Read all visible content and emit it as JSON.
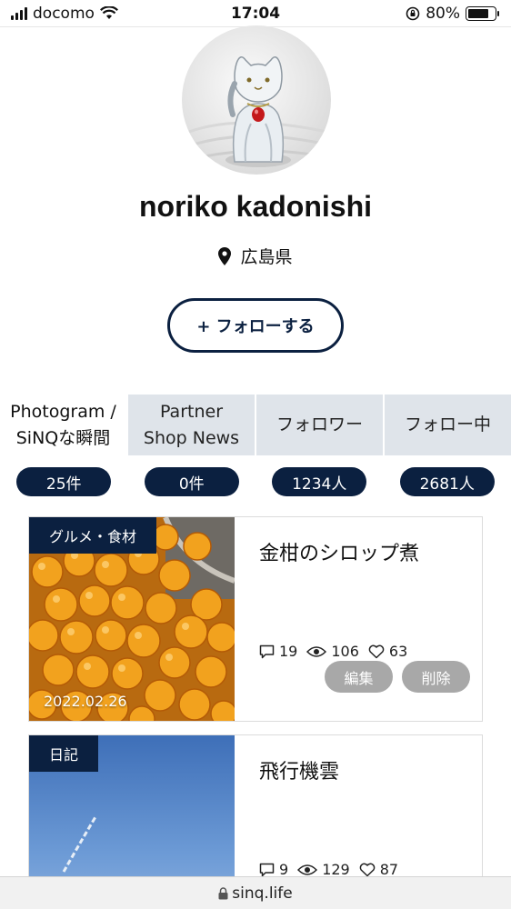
{
  "status_bar": {
    "carrier": "docomo",
    "time": "17:04",
    "battery": "80%"
  },
  "profile": {
    "name": "noriko kadonishi",
    "location": "広島県",
    "follow_button": "+ フォローする"
  },
  "tabs": [
    {
      "label": "Photogram /\nSiNQな瞬間",
      "count": "25件"
    },
    {
      "label": "Partner\nShop News",
      "count": "0件"
    },
    {
      "label": "フォロワー",
      "count": "1234人"
    },
    {
      "label": "フォロー中",
      "count": "2681人"
    }
  ],
  "posts": [
    {
      "category": "グルメ・食材",
      "date": "2022.02.26",
      "title": "金柑のシロップ煮",
      "comments": "19",
      "views": "106",
      "likes": "63",
      "edit": "編集",
      "delete": "削除"
    },
    {
      "category": "日記",
      "title": "飛行機雲",
      "comments": "9",
      "views": "129",
      "likes": "87"
    }
  ],
  "browser": {
    "url": "sinq.life"
  }
}
